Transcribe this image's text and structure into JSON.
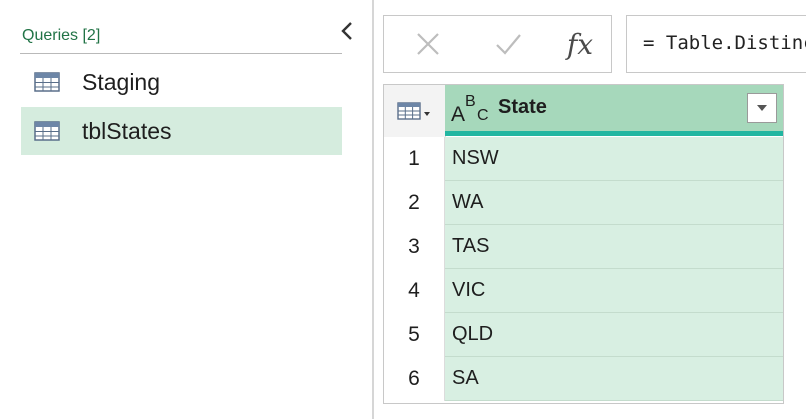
{
  "queries_pane": {
    "header": "Queries [2]",
    "items": [
      {
        "label": "Staging",
        "selected": false
      },
      {
        "label": "tblStates",
        "selected": true
      }
    ]
  },
  "formula_bar": {
    "fx_label": "fx",
    "formula": "= Table.Distinct"
  },
  "grid": {
    "column": {
      "type_a": "A",
      "type_b": "B",
      "type_c": "C",
      "name": "State"
    },
    "rows": [
      {
        "num": "1",
        "value": "NSW"
      },
      {
        "num": "2",
        "value": "WA"
      },
      {
        "num": "3",
        "value": "TAS"
      },
      {
        "num": "4",
        "value": "VIC"
      },
      {
        "num": "5",
        "value": "QLD"
      },
      {
        "num": "6",
        "value": "SA"
      }
    ]
  },
  "colors": {
    "accent_green": "#217346",
    "selected_bg": "#d5ecde",
    "column_header": "#a6d8bb",
    "column_bar": "#21b6a1",
    "cell_bg": "#d8efe2"
  },
  "icons": {
    "collapse": "chevron-left-icon",
    "query": "table-icon",
    "cancel": "close-icon",
    "commit": "check-icon",
    "table_menu": "table-menu-icon",
    "filter": "dropdown-arrow-icon"
  }
}
